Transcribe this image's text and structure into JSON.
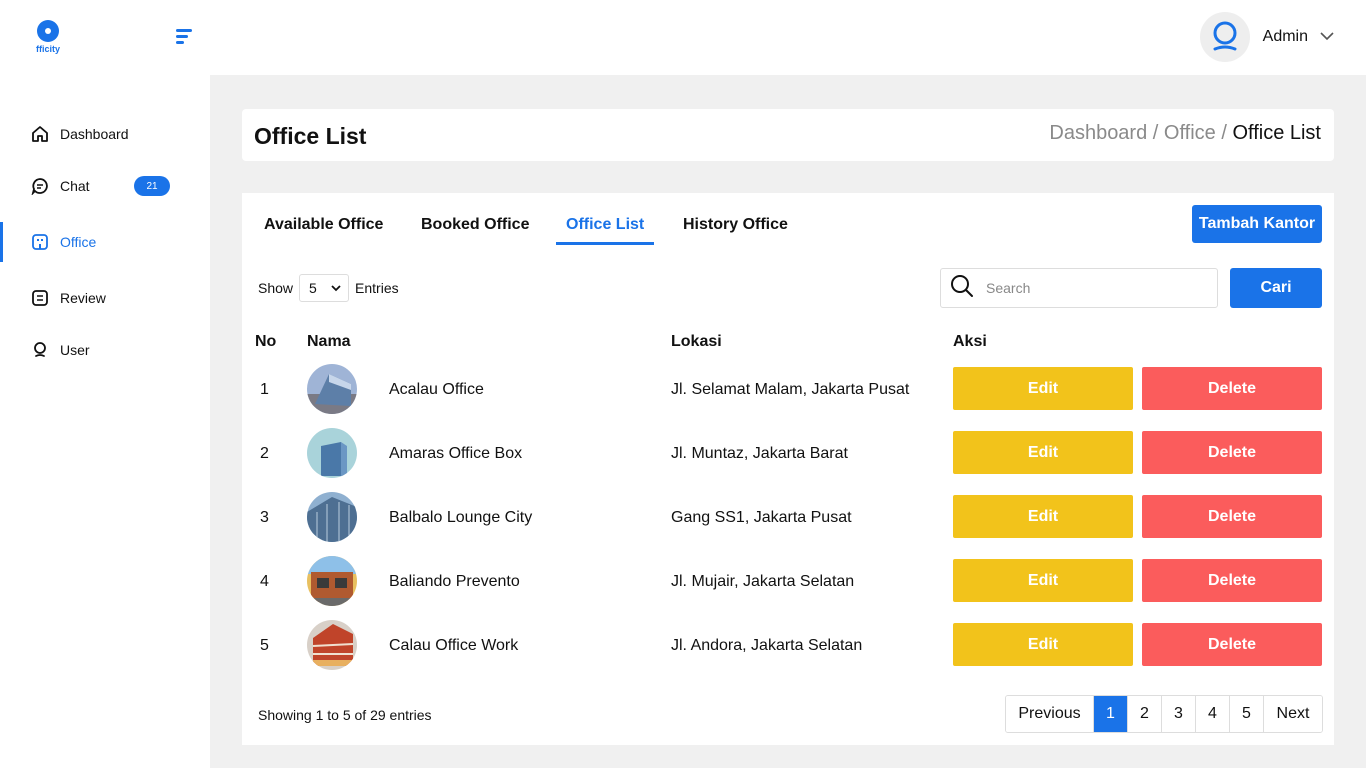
{
  "brand": {
    "logo_text": "fficity",
    "accent": "#1a73e8"
  },
  "header": {
    "user_name": "Admin"
  },
  "sidebar": {
    "items": [
      {
        "label": "Dashboard",
        "icon": "home-icon"
      },
      {
        "label": "Chat",
        "icon": "chat-icon",
        "badge": "21"
      },
      {
        "label": "Office",
        "icon": "office-icon",
        "active": true
      },
      {
        "label": "Review",
        "icon": "review-icon"
      },
      {
        "label": "User",
        "icon": "user-icon"
      }
    ]
  },
  "page": {
    "title": "Office List",
    "breadcrumb": {
      "part1": "Dashboard",
      "part2": "Office",
      "current": "Office List",
      "separator": " / "
    }
  },
  "tabs": [
    {
      "label": "Available Office"
    },
    {
      "label": "Booked Office"
    },
    {
      "label": "Office List",
      "active": true
    },
    {
      "label": "History Office"
    }
  ],
  "actions": {
    "add_label": "Tambah Kantor",
    "search_button": "Cari"
  },
  "controls": {
    "show_label": "Show",
    "entries_value": "5",
    "entries_label": "Entries",
    "search_placeholder": "Search"
  },
  "table": {
    "columns": {
      "no": "No",
      "nama": "Nama",
      "lokasi": "Lokasi",
      "aksi": "Aksi"
    },
    "edit_label": "Edit",
    "delete_label": "Delete",
    "rows": [
      {
        "no": "1",
        "nama": "Acalau Office",
        "lokasi": "Jl. Selamat Malam, Jakarta Pusat"
      },
      {
        "no": "2",
        "nama": "Amaras Office Box",
        "lokasi": "Jl. Muntaz, Jakarta Barat"
      },
      {
        "no": "3",
        "nama": "Balbalo Lounge City",
        "lokasi": "Gang SS1, Jakarta Pusat"
      },
      {
        "no": "4",
        "nama": "Baliando Prevento",
        "lokasi": "Jl. Mujair, Jakarta Selatan"
      },
      {
        "no": "5",
        "nama": "Calau Office Work",
        "lokasi": "Jl. Andora, Jakarta Selatan"
      }
    ]
  },
  "footer": {
    "info": "Showing 1 to 5 of 29 entries",
    "previous": "Previous",
    "next": "Next",
    "pages": [
      "1",
      "2",
      "3",
      "4",
      "5"
    ],
    "current_page": "1"
  },
  "colors": {
    "edit": "#f2c31b",
    "delete": "#fb5c5c",
    "primary": "#1a73e8"
  }
}
